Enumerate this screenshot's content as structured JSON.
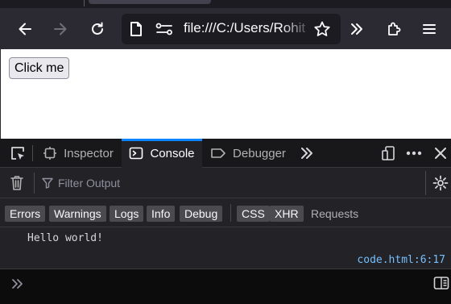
{
  "browser": {
    "url": "file:///C:/Users/Rohit",
    "url_title": "file:///C:/Users/Rohit/code.html"
  },
  "page": {
    "button_label": "Click me"
  },
  "devtools": {
    "tabs": [
      {
        "label": "Inspector",
        "icon": "inspector-icon"
      },
      {
        "label": "Console",
        "icon": "console-icon",
        "active": true
      },
      {
        "label": "Debugger",
        "icon": "debugger-icon"
      }
    ],
    "filter_placeholder": "Filter Output",
    "filters": [
      "Errors",
      "Warnings",
      "Logs",
      "Info",
      "Debug"
    ],
    "net_filters": [
      "CSS",
      "XHR"
    ],
    "requests_label": "Requests",
    "messages": [
      {
        "text": "Hello world!",
        "location": "code.html:6:17"
      }
    ]
  },
  "colors": {
    "accent": "#0a84ff",
    "link": "#75bfff",
    "chip_bg": "#4a4a4f"
  }
}
